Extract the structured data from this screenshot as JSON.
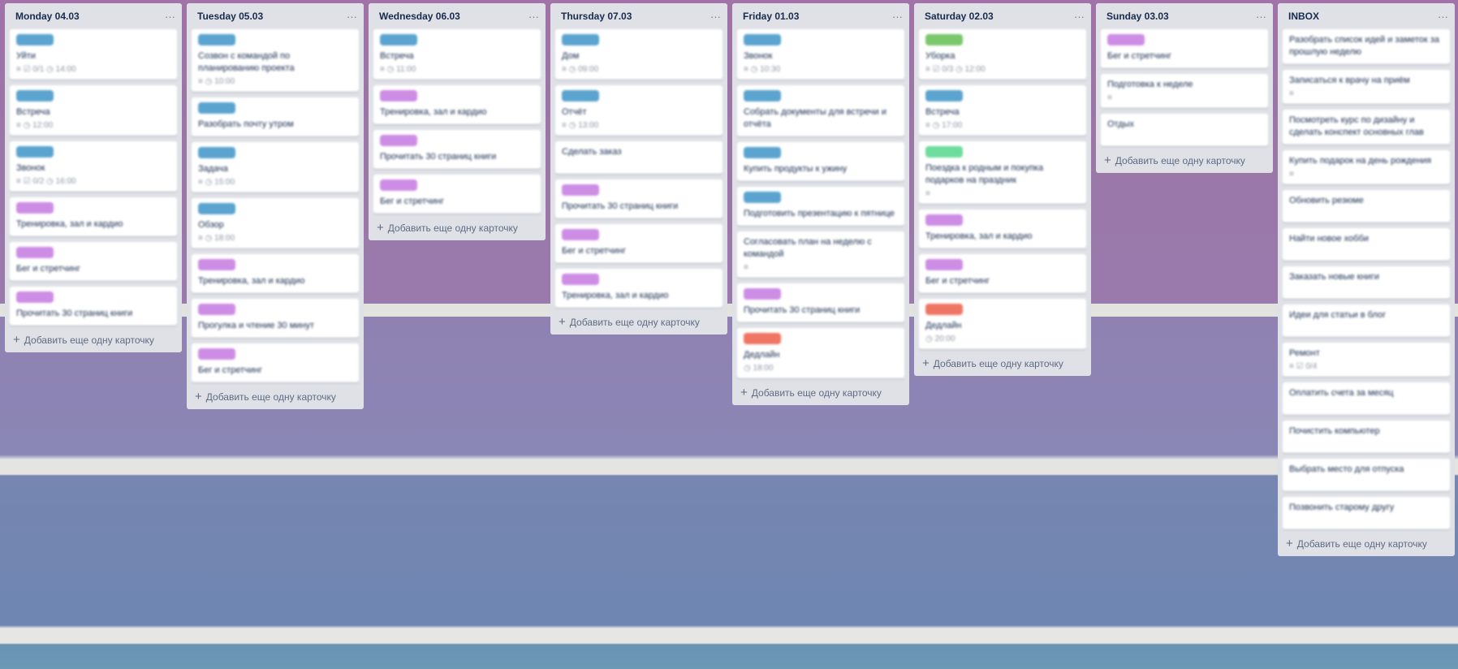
{
  "colors": {
    "blue": "#5ba4cf",
    "purple": "#cd8de5",
    "green": "#7bc86c",
    "mint": "#6ddc9c",
    "orange": "#ef7564"
  },
  "add_card_label": "Добавить еще одну карточку",
  "menu_icon": "···",
  "lists": [
    {
      "title": "Monday 04.03",
      "cards": [
        {
          "label": "blue",
          "title": "Уйти",
          "meta": "≡  ☑ 0/1  ◷ 14:00"
        },
        {
          "label": "blue",
          "title": "Встреча",
          "meta": "≡  ◷ 12:00"
        },
        {
          "label": "blue",
          "title": "Звонок",
          "meta": "≡  ☑ 0/2  ◷ 16:00"
        },
        {
          "label": "purple",
          "title": "Тренировка, зал и кардио"
        },
        {
          "label": "purple",
          "title": "Бег и стретчинг"
        },
        {
          "label": "purple",
          "title": "Прочитать 30 страниц книги"
        }
      ]
    },
    {
      "title": "Tuesday 05.03",
      "cards": [
        {
          "label": "blue",
          "title": "Созвон с командой по планированию проекта",
          "meta": "≡  ◷ 10:00"
        },
        {
          "label": "blue",
          "title": "Разобрать почту утром"
        },
        {
          "label": "blue",
          "title": "Задача",
          "meta": "≡  ◷ 15:00"
        },
        {
          "label": "blue",
          "title": "Обзор",
          "meta": "≡  ◷ 18:00"
        },
        {
          "label": "purple",
          "title": "Тренировка, зал и кардио"
        },
        {
          "label": "purple",
          "title": "Прогулка и чтение 30 минут"
        },
        {
          "label": "purple",
          "title": "Бег и стретчинг"
        }
      ]
    },
    {
      "title": "Wednesday 06.03",
      "cards": [
        {
          "label": "blue",
          "title": "Встреча",
          "meta": "≡  ◷ 11:00"
        },
        {
          "label": "purple",
          "title": "Тренировка, зал и кардио"
        },
        {
          "label": "purple",
          "title": "Прочитать 30 страниц книги"
        },
        {
          "label": "purple",
          "title": "Бег и стретчинг"
        }
      ]
    },
    {
      "title": "Thursday 07.03",
      "cards": [
        {
          "label": "blue",
          "title": "Дом",
          "meta": "≡  ◷ 09:00"
        },
        {
          "label": "blue",
          "title": "Отчёт",
          "meta": "≡  ◷ 13:00"
        },
        {
          "label": "",
          "title": "Сделать заказ"
        },
        {
          "label": "purple",
          "title": "Прочитать 30 страниц книги"
        },
        {
          "label": "purple",
          "title": "Бег и стретчинг"
        },
        {
          "label": "purple",
          "title": "Тренировка, зал и кардио"
        }
      ]
    },
    {
      "title": "Friday 01.03",
      "cards": [
        {
          "label": "blue",
          "title": "Звонок",
          "meta": "≡  ◷ 10:30"
        },
        {
          "label": "blue",
          "title": "Собрать документы для встречи и отчёта"
        },
        {
          "label": "blue",
          "title": "Купить продукты к ужину"
        },
        {
          "label": "blue",
          "title": "Подготовить презентацию к пятнице"
        },
        {
          "label": "",
          "title": "Согласовать план на неделю с командой",
          "meta": "≡"
        },
        {
          "label": "purple",
          "title": "Прочитать 30 страниц книги"
        },
        {
          "label": "orange",
          "title": "Дедлайн",
          "meta": "◷ 18:00"
        }
      ]
    },
    {
      "title": "Saturday 02.03",
      "cards": [
        {
          "label": "green",
          "title": "Уборка",
          "meta": "≡  ☑ 0/3  ◷ 12:00"
        },
        {
          "label": "blue",
          "title": "Встреча",
          "meta": "≡  ◷ 17:00"
        },
        {
          "label": "mint",
          "title": "Поездка к родным и покупка подарков на праздник",
          "meta": "≡"
        },
        {
          "label": "purple",
          "title": "Тренировка, зал и кардио"
        },
        {
          "label": "purple",
          "title": "Бег и стретчинг"
        },
        {
          "label": "orange",
          "title": "Дедлайн",
          "meta": "◷ 20:00"
        }
      ]
    },
    {
      "title": "Sunday 03.03",
      "cards": [
        {
          "label": "purple",
          "title": "Бег и стретчинг"
        },
        {
          "label": "",
          "title": "Подготовка к неделе",
          "meta": "≡"
        },
        {
          "label": "",
          "title": "Отдых"
        }
      ]
    },
    {
      "title": "INBOX",
      "cards": [
        {
          "label": "",
          "title": "Разобрать список идей и заметок за прошлую неделю"
        },
        {
          "label": "",
          "title": "Записаться к врачу на приём",
          "meta": "≡"
        },
        {
          "label": "",
          "title": "Посмотреть курс по дизайну и сделать конспект основных глав"
        },
        {
          "label": "",
          "title": "Купить подарок на день рождения",
          "meta": "≡"
        },
        {
          "label": "",
          "title": "Обновить резюме"
        },
        {
          "label": "",
          "title": "Найти новое хобби"
        },
        {
          "label": "",
          "title": "Заказать новые книги"
        },
        {
          "label": "",
          "title": "Идеи для статьи в блог"
        },
        {
          "label": "",
          "title": "Ремонт",
          "meta": "≡  ☑ 0/4"
        },
        {
          "label": "",
          "title": "Оплатить счета за месяц"
        },
        {
          "label": "",
          "title": "Почистить компьютер"
        },
        {
          "label": "",
          "title": "Выбрать место для отпуска"
        },
        {
          "label": "",
          "title": "Позвонить старому другу"
        }
      ]
    }
  ]
}
